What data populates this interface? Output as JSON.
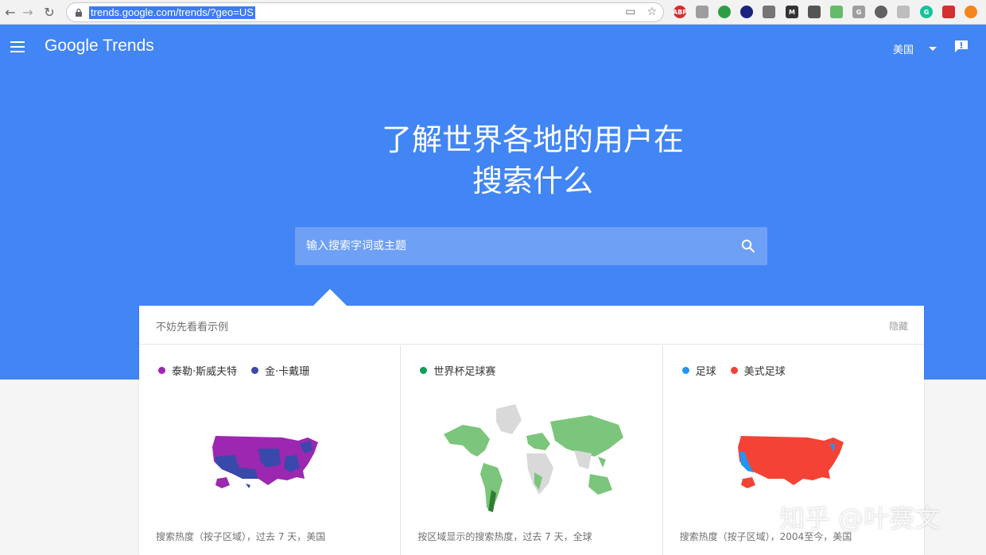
{
  "browser": {
    "url": "trends.google.com/trends/?geo=US"
  },
  "header": {
    "logo": "Google Trends",
    "region": "美国"
  },
  "hero": {
    "line1": "了解世界各地的用户在",
    "line2": "搜索什么"
  },
  "search": {
    "placeholder": "输入搜索字词或主题"
  },
  "examples": {
    "title": "不妨先看看示例",
    "hide_label": "隐藏",
    "cards": [
      {
        "legend": [
          {
            "label": "泰勒·斯威夫特",
            "color": "#9c27b0"
          },
          {
            "label": "金·卡戴珊",
            "color": "#3949ab"
          }
        ],
        "caption": "搜索热度（按子区域），过去 7 天，美国"
      },
      {
        "legend": [
          {
            "label": "世界杯足球赛",
            "color": "#0f9d58"
          }
        ],
        "caption": "按区域显示的搜索热度，过去 7 天，全球"
      },
      {
        "legend": [
          {
            "label": "足球",
            "color": "#2196f3"
          },
          {
            "label": "美式足球",
            "color": "#f44336"
          }
        ],
        "caption": "搜索热度（按子区域），2004至今，美国"
      }
    ]
  },
  "watermark": "知乎 @叶赛文"
}
